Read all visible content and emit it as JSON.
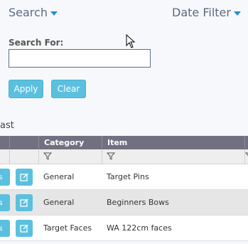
{
  "header": {
    "search_label": "Search",
    "date_filter_label": "Date Filter"
  },
  "search_form": {
    "field_label": "Search For:",
    "input_value": "",
    "apply_label": "Apply",
    "clear_label": "Clear"
  },
  "section": {
    "title": "ast"
  },
  "table": {
    "columns": [
      "Category",
      "Item"
    ],
    "rows": [
      {
        "left_button_label": "s",
        "category": "General",
        "item": "Target Pins"
      },
      {
        "left_button_label": "s",
        "category": "General",
        "item": "Beginners Bows"
      },
      {
        "left_button_label": "s",
        "category": "Target Faces",
        "item": "WA 122cm faces"
      }
    ]
  },
  "colors": {
    "accent": "#5bc0de",
    "header_bg": "#707080",
    "caret": "#1e90d6"
  },
  "icons": [
    "caret-down-icon",
    "mouse-cursor-icon",
    "filter-icon",
    "edit-icon"
  ]
}
